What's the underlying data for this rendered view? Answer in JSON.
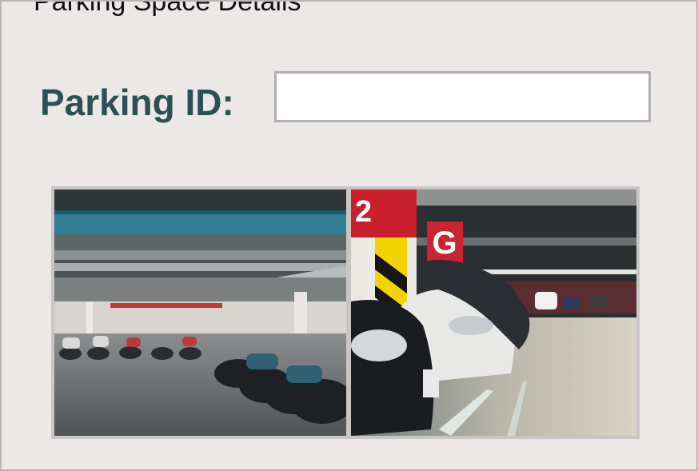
{
  "page": {
    "title": "Parking Space Details"
  },
  "form": {
    "parking_id_label": "Parking ID:",
    "parking_id_value": "",
    "parking_id_placeholder": ""
  },
  "gallery": {
    "images": [
      {
        "subject": "motorcycle-parking-garage-photo"
      },
      {
        "subject": "car-parking-garage-photo"
      }
    ]
  },
  "colors": {
    "label_text": "#2c5053",
    "background": "#ece8e7",
    "input_border": "#b2b0ae"
  }
}
